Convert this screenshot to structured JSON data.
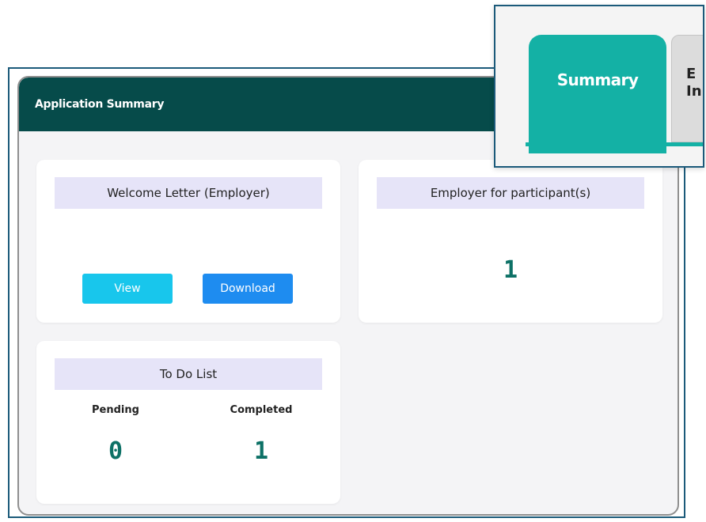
{
  "panel": {
    "title": "Application Summary"
  },
  "welcome_card": {
    "title": "Welcome Letter (Employer)",
    "view_label": "View",
    "download_label": "Download"
  },
  "employer_card": {
    "title": "Employer for participant(s)",
    "count": "1"
  },
  "todo_card": {
    "title": "To Do List",
    "pending_label": "Pending",
    "pending_count": "0",
    "completed_label": "Completed",
    "completed_count": "1"
  },
  "inset_tabs": {
    "active_tab": "Summary",
    "next_tab_line1": "E",
    "next_tab_line2": "In"
  },
  "colors": {
    "header_bg": "#064b4a",
    "card_head_bg": "#e6e4f8",
    "view_button": "#18c6ec",
    "download_button": "#1e8cf0",
    "number_color": "#0d7166",
    "active_tab": "#14b1a5"
  }
}
